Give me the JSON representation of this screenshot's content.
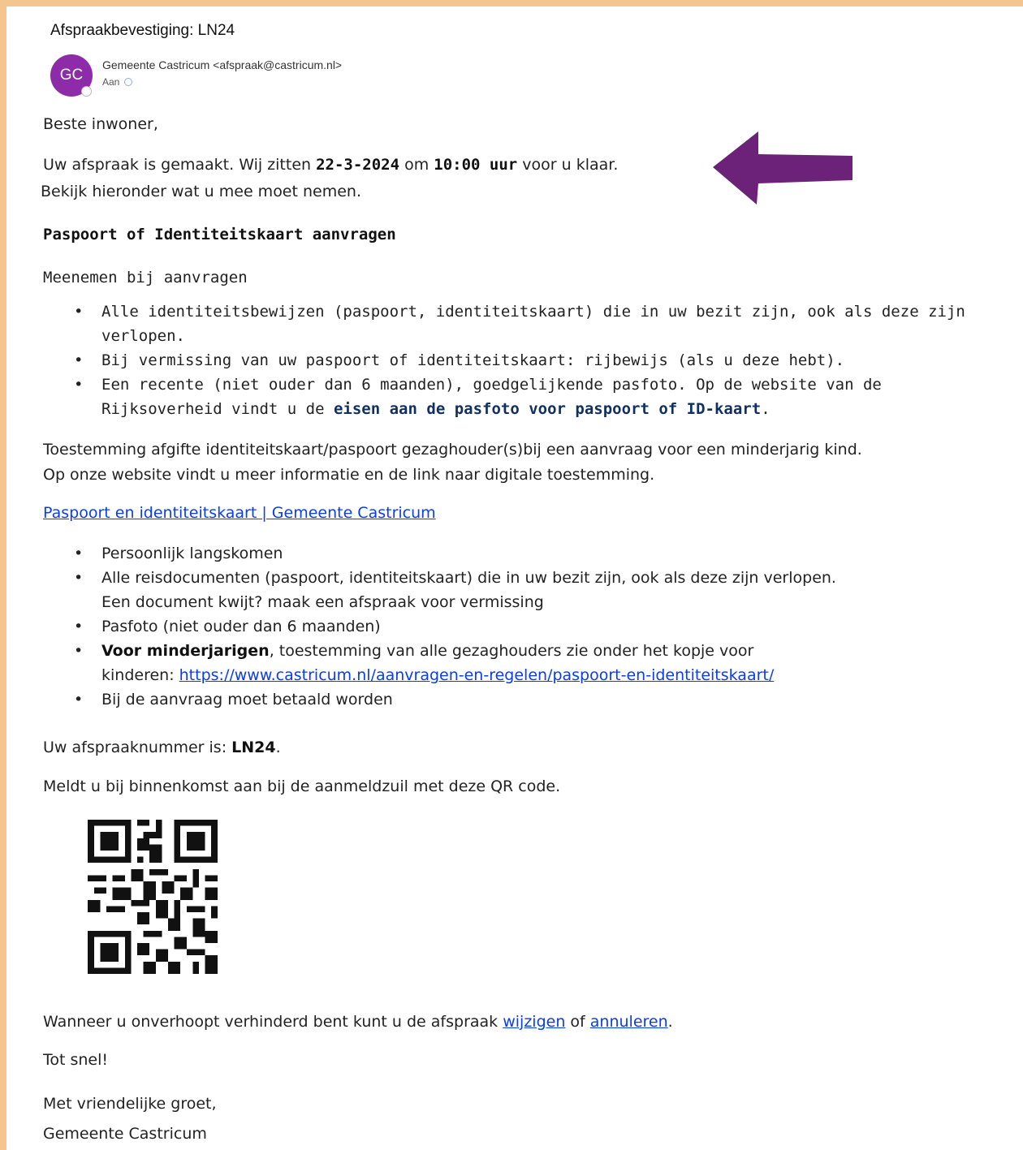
{
  "header": {
    "subject": "Afspraakbevestiging: LN24",
    "avatar_initials": "GC",
    "avatar_color": "#8e2ba8",
    "sender": "Gemeente Castricum <afspraak@castricum.nl>",
    "to_label": "Aan"
  },
  "body": {
    "greeting": "Beste inwoner,",
    "appt_prefix": "Uw afspraak is gemaakt. Wij zitten ",
    "appt_date": "22-3-2024",
    "appt_mid": " om ",
    "appt_time": "10:00 uur",
    "appt_suffix": " voor u klaar.",
    "appt_line2": "Bekijk hieronder wat u mee moet nemen.",
    "section_title": "Paspoort of Identiteitskaart aanvragen",
    "bring_label": "Meenemen bij aanvragen",
    "bring_items": [
      "Alle identiteitsbewijzen (paspoort, identiteitskaart) die in uw bezit zijn, ook als deze zijn",
      "verlopen.",
      "Bij vermissing van uw paspoort of identiteitskaart: rijbewijs (als u deze hebt).",
      "Een recente (niet ouder dan 6 maanden), goedgelijkende pasfoto. Op de website van de",
      "Rijksoverheid vindt u de ",
      "eisen aan de pasfoto voor paspoort of ID-kaart",
      "."
    ],
    "consent_line1": "Toestemming afgifte identiteitskaart/paspoort gezaghouder(s)bij een aanvraag voor een minderjarig kind.",
    "consent_line2": "Op onze website vindt u meer informatie en de link naar digitale toestemming.",
    "page_link": "Paspoort en identiteitskaart | Gemeente Castricum",
    "items2": {
      "i1": "Persoonlijk langskomen",
      "i2a": "Alle reisdocumenten (paspoort, identiteitskaart) die in uw bezit zijn, ook als deze zijn verlopen.",
      "i2b": "Een document kwijt? maak een afspraak voor vermissing",
      "i3": "Pasfoto (niet ouder dan 6 maanden)",
      "i4_bold": "Voor minderjarigen",
      "i4_rest": ", toestemming van alle gezaghouders zie onder het kopje voor",
      "i4_prefix2": "kinderen: ",
      "i4_url": "https://www.castricum.nl/aanvragen-en-regelen/paspoort-en-identiteitskaart/",
      "i5": "Bij de aanvraag moet betaald worden"
    },
    "number_prefix": "Uw afspraaknummer is: ",
    "number": "LN24",
    "number_suffix": ".",
    "qr_text": "Meldt u bij binnenkomst aan bij de aanmeldzuil met deze QR code.",
    "change_prefix": "Wanneer u onverhoopt verhinderd bent kunt u de afspraak ",
    "change_link": "wijzigen",
    "change_mid": " of ",
    "cancel_link": "annuleren",
    "change_suffix": ".",
    "see_you": "Tot snel!",
    "regards": "Met vriendelijke groet,",
    "signature": "Gemeente Castricum"
  },
  "annotation": {
    "arrow_color": "#6b2278"
  }
}
